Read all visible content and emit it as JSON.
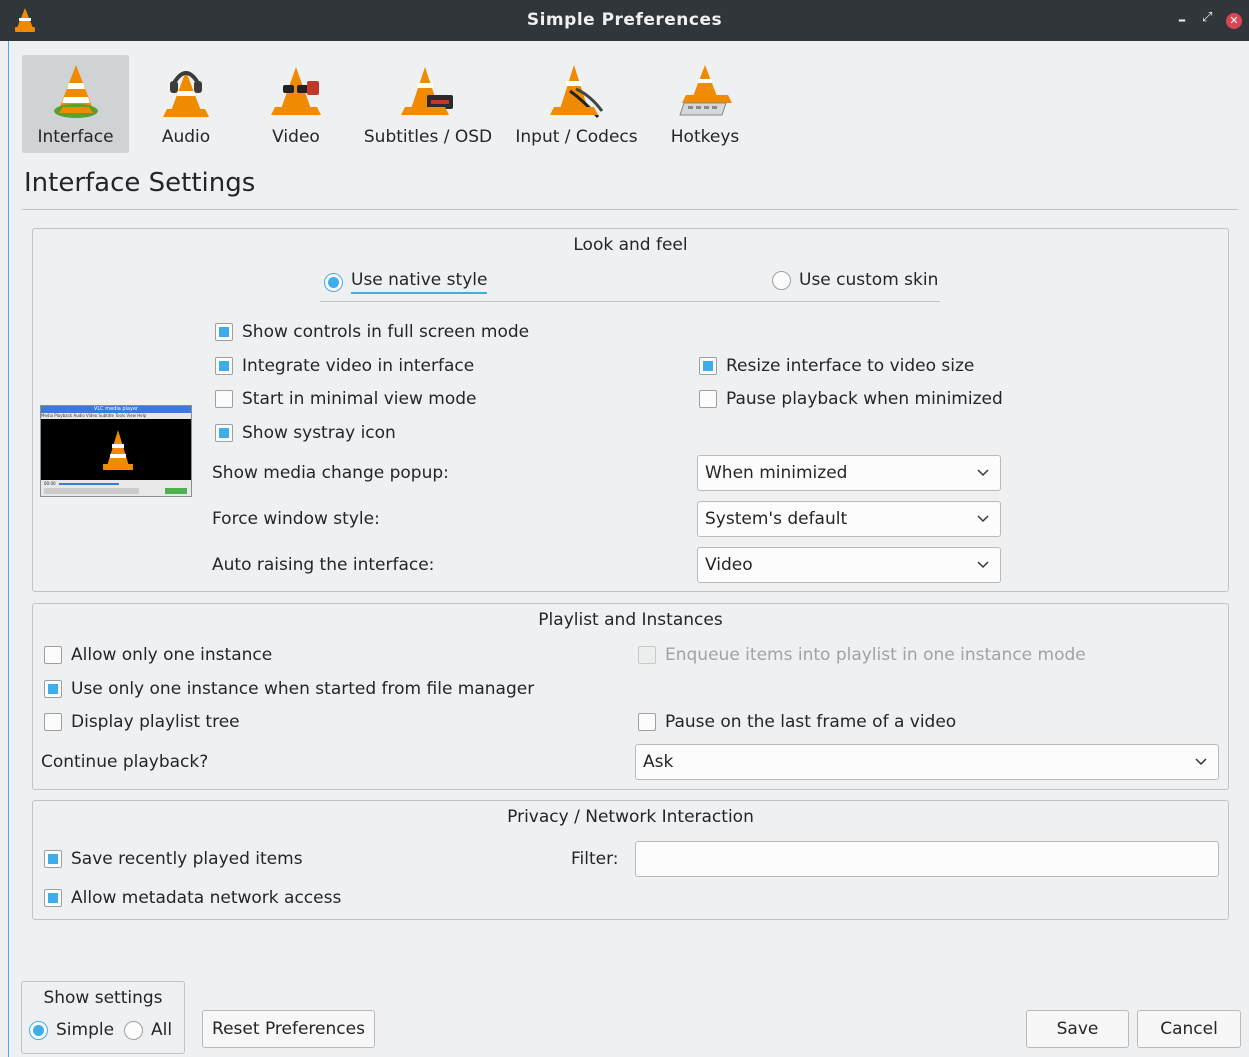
{
  "window": {
    "title": "Simple Preferences",
    "controls": {
      "minimize": "–",
      "restore": "⤢",
      "close": "⊗"
    }
  },
  "categories": [
    {
      "label": "Interface",
      "icon": "vlc-cone-interface-icon",
      "active": true
    },
    {
      "label": "Audio",
      "icon": "vlc-cone-headphones-icon",
      "active": false
    },
    {
      "label": "Video",
      "icon": "vlc-cone-glasses-icon",
      "active": false
    },
    {
      "label": "Subtitles / OSD",
      "icon": "vlc-cone-subtitles-icon",
      "active": false
    },
    {
      "label": "Input / Codecs",
      "icon": "vlc-cone-cables-icon",
      "active": false
    },
    {
      "label": "Hotkeys",
      "icon": "vlc-cone-keyboard-icon",
      "active": false
    }
  ],
  "page_title": "Interface Settings",
  "look_and_feel": {
    "title": "Look and feel",
    "native_style": "Use native style",
    "custom_skin": "Use custom skin",
    "selected_style": "native",
    "show_controls": {
      "label": "Show controls in full screen mode",
      "checked": true
    },
    "integrate_video": {
      "label": "Integrate video in interface",
      "checked": true
    },
    "resize_interface": {
      "label": "Resize interface to video size",
      "checked": true
    },
    "minimal_view": {
      "label": "Start in minimal view mode",
      "checked": false
    },
    "pause_minimized": {
      "label": "Pause playback when minimized",
      "checked": false
    },
    "systray": {
      "label": "Show systray icon",
      "checked": true
    },
    "media_popup_label": "Show media change popup:",
    "media_popup_value": "When minimized",
    "window_style_label": "Force window style:",
    "window_style_value": "System's default",
    "auto_raise_label": "Auto raising the interface:",
    "auto_raise_value": "Video",
    "preview_text": "VLC media player",
    "preview_menu": "Media  Playback  Audio  Video  Subtitle  Tools  View  Help",
    "preview_time": "00:00"
  },
  "playlist": {
    "title": "Playlist and Instances",
    "one_instance": {
      "label": "Allow only one instance",
      "checked": false
    },
    "enqueue": {
      "label": "Enqueue items into playlist in one instance mode",
      "checked": false,
      "disabled": true
    },
    "file_manager": {
      "label": "Use only one instance when started from file manager",
      "checked": true
    },
    "playlist_tree": {
      "label": "Display playlist tree",
      "checked": false
    },
    "pause_last_frame": {
      "label": "Pause on the last frame of a video",
      "checked": false
    },
    "continue_label": "Continue playback?",
    "continue_value": "Ask"
  },
  "privacy": {
    "title": "Privacy / Network Interaction",
    "save_recent": {
      "label": "Save recently played items",
      "checked": true
    },
    "filter_label": "Filter:",
    "filter_value": "",
    "metadata": {
      "label": "Allow metadata network access",
      "checked": true
    }
  },
  "footer": {
    "show_settings_title": "Show settings",
    "simple": "Simple",
    "all": "All",
    "selected_mode": "simple",
    "reset": "Reset Preferences",
    "save": "Save",
    "cancel": "Cancel"
  },
  "colors": {
    "accent": "#3daee9",
    "titlebar": "#31363b",
    "window": "#eff0f1",
    "cone_orange": "#f08a00"
  }
}
